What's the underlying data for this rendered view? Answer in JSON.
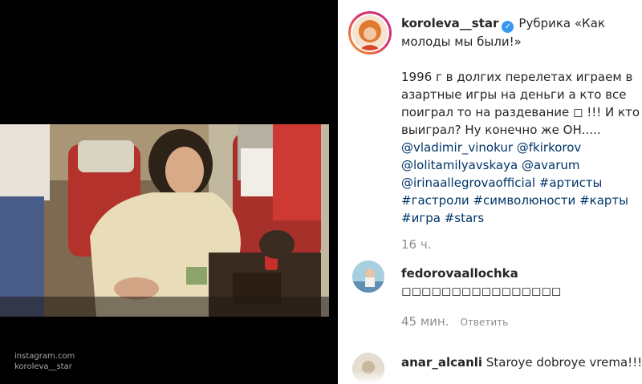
{
  "media": {
    "watermark_line1": "instagram.com",
    "watermark_line2": "koroleva__star"
  },
  "post": {
    "username": "koroleva__star",
    "verified_icon": "✓",
    "caption_title": "Рубрика «Как молоды мы были!»",
    "caption_body": "1996 г в долгих перелетах играем в азартные игры на деньги а кто все поиграл то на раздевание ◻ !!! И кто выиграл? Ну конечно же ОН.....",
    "mentions": [
      "@vladimir_vinokur",
      "@fkirkorov",
      "@lolitamilyavskaya",
      "@avarum",
      "@irinaallegrovaofficial"
    ],
    "hashtags": [
      "#артисты",
      "#гастроли",
      "#символюности",
      "#карты",
      "#игра",
      "#stars"
    ],
    "time_ago": "16 ч."
  },
  "comments": [
    {
      "username": "fedorovaallochka",
      "text": "◻◻◻◻◻◻◻◻◻◻◻◻◻◻◻◻",
      "time_ago": "45 мин.",
      "reply_label": "Ответить"
    },
    {
      "username": "anar_alcanli",
      "text": "Staroye dobroye vrema!!!!"
    }
  ],
  "colors": {
    "link": "#003569",
    "meta": "#8e8e8e",
    "verified": "#3897f0"
  }
}
